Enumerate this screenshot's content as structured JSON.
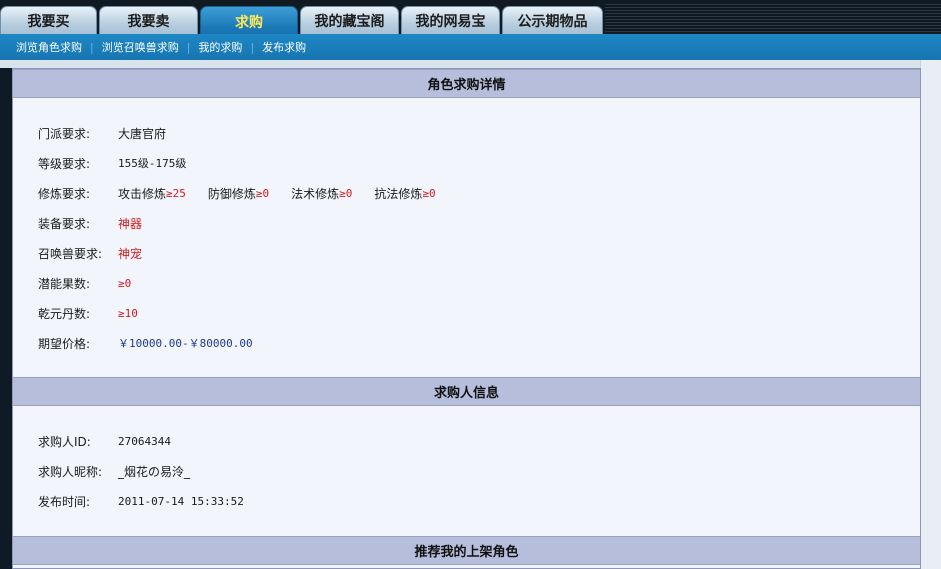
{
  "tabs": [
    {
      "label": "我要买",
      "active": false
    },
    {
      "label": "我要卖",
      "active": false
    },
    {
      "label": "求购",
      "active": true
    },
    {
      "label": "我的藏宝阁",
      "active": false
    },
    {
      "label": "我的网易宝",
      "active": false
    },
    {
      "label": "公示期物品",
      "active": false
    }
  ],
  "subnav": [
    "浏览角色求购",
    "浏览召唤兽求购",
    "我的求购",
    "发布求购"
  ],
  "detail": {
    "title": "角色求购详情",
    "school_label": "门派要求:",
    "school_value": "大唐官府",
    "level_label": "等级要求:",
    "level_value": "155级-175级",
    "cultivation_label": "修炼要求:",
    "cultivation": [
      {
        "name": "攻击修炼",
        "value": "≥25"
      },
      {
        "name": "防御修炼",
        "value": "≥0"
      },
      {
        "name": "法术修炼",
        "value": "≥0"
      },
      {
        "name": "抗法修炼",
        "value": "≥0"
      }
    ],
    "equip_label": "装备要求:",
    "equip_value": "神器",
    "pet_label": "召唤兽要求:",
    "pet_value": "神宠",
    "potential_label": "潜能果数:",
    "potential_value": "≥0",
    "qianyuan_label": "乾元丹数:",
    "qianyuan_value": "≥10",
    "price_label": "期望价格:",
    "price_value": "￥10000.00-￥80000.00"
  },
  "buyer": {
    "title": "求购人信息",
    "id_label": "求购人ID:",
    "id_value": "27064344",
    "nick_label": "求购人昵称:",
    "nick_value": "_烟花の易泠_",
    "time_label": "发布时间:",
    "time_value": "2011-07-14 15:33:52"
  },
  "recommend": {
    "title": "推荐我的上架角色"
  },
  "colors": {
    "accent": "#1b79b8",
    "highlight": "#d21b1b",
    "price": "#1e3a8a",
    "active_tab_text": "#ffe85a"
  }
}
